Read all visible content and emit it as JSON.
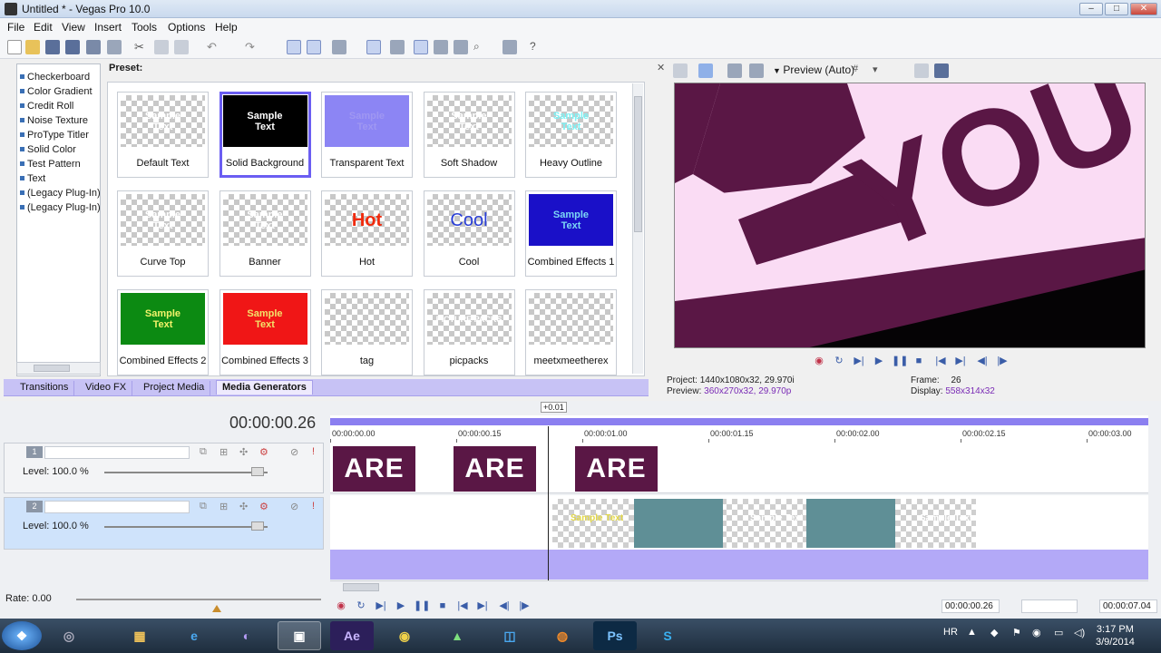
{
  "window": {
    "title": "Untitled * - Vegas Pro 10.0"
  },
  "menu": [
    "File",
    "Edit",
    "View",
    "Insert",
    "Tools",
    "Options",
    "Help"
  ],
  "tree": {
    "items": [
      "Checkerboard",
      "Color Gradient",
      "Credit Roll",
      "Noise Texture",
      "ProType Titler",
      "Solid Color",
      "Test Pattern",
      "Text",
      "(Legacy Plug-In) T",
      "(Legacy Plug-In) V"
    ]
  },
  "preset": {
    "label": "Preset:",
    "tiles": [
      {
        "label": "Default Text",
        "thumb": "Sample\nText",
        "fg": "#ffffff",
        "bg": ""
      },
      {
        "label": "Solid Background",
        "thumb": "Sample\nText",
        "fg": "#ffffff",
        "bg": "#000000"
      },
      {
        "label": "Transparent Text",
        "thumb": "Sample\nText",
        "fg": "#9f97f2",
        "bg": "#8c85f4"
      },
      {
        "label": "Soft Shadow",
        "thumb": "Sample\nText",
        "fg": "#ffffff",
        "bg": ""
      },
      {
        "label": "Heavy Outline",
        "thumb": "Sample\nText",
        "fg": "#7cf2f5",
        "bg": ""
      },
      {
        "label": "Curve Top",
        "thumb": "Sample\nText",
        "fg": "#ffffff",
        "bg": ""
      },
      {
        "label": "Banner",
        "thumb": "Sample\nText",
        "fg": "#ffffff",
        "bg": ""
      },
      {
        "label": "Hot",
        "thumb": "Hot",
        "fg": "#f02a0c",
        "bg": ""
      },
      {
        "label": "Cool",
        "thumb": "Cool",
        "fg": "#2a3fd6",
        "bg": ""
      },
      {
        "label": "Combined Effects 1",
        "thumb": "Sample\nText",
        "fg": "#7cd7f5",
        "bg": "#1a10c8"
      },
      {
        "label": "Combined Effects 2",
        "thumb": "Sample\nText",
        "fg": "#f2f26a",
        "bg": "#0c8a12"
      },
      {
        "label": "Combined Effects 3",
        "thumb": "Sample\nText",
        "fg": "#f2e26a",
        "bg": "#f01616"
      },
      {
        "label": "tag",
        "thumb": "",
        "fg": "#ffffff",
        "bg": ""
      },
      {
        "label": "picpacks",
        "thumb": "PICTURE PACKS",
        "fg": "#ffffff",
        "bg": ""
      },
      {
        "label": "meetxmeetherex",
        "thumb": "",
        "fg": "#ffffff",
        "bg": ""
      }
    ]
  },
  "tabs": [
    "Transitions",
    "Video FX",
    "Project Media",
    "Media Generators"
  ],
  "active_tab": "Media Generators",
  "preview": {
    "mode": "Preview (Auto)",
    "big_text": "YOU",
    "project_label": "Project:",
    "project_value": "1440x1080x32, 29.970i",
    "preview_label": "Preview:",
    "preview_value": "360x270x32, 29.970p",
    "frame_label": "Frame:",
    "frame_value": "26",
    "display_label": "Display:",
    "display_value": "558x314x32"
  },
  "timeline": {
    "timecode": "00:00:00.26",
    "offset_marker": "+0.01",
    "ruler_ticks": [
      "00:00:00.00",
      "00:00:00.15",
      "00:00:01.00",
      "00:00:01.15",
      "00:00:02.00",
      "00:00:02.15",
      "00:00:03.00"
    ],
    "tracks": [
      {
        "num": "1",
        "level": "Level: 100.0 %"
      },
      {
        "num": "2",
        "level": "Level: 100.0 %"
      }
    ],
    "clip_text": "ARE",
    "sample_text": "Sample\nText"
  },
  "transport": {
    "rate": "Rate: 0.00",
    "position": "00:00:00.26",
    "length": "00:00:07.04"
  },
  "taskbar": {
    "apps": [
      "start",
      "ie",
      "explorer",
      "chrome-like",
      "cmd",
      "after-effects",
      "chrome",
      "sony",
      "media",
      "firefox",
      "photoshop",
      "skype"
    ],
    "lang": "HR",
    "time": "3:17 PM",
    "date": "3/9/2014",
    "ae_label": "Ae",
    "ps_label": "Ps"
  }
}
